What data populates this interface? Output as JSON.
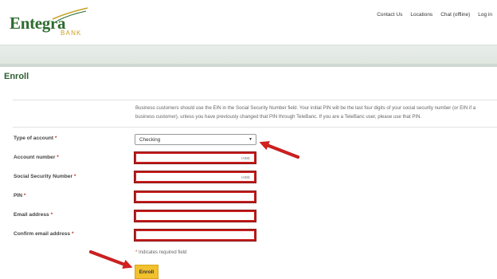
{
  "brand": {
    "name": "Entegra",
    "sub": "BANK"
  },
  "nav": {
    "contact": "Contact Us",
    "locations": "Locations",
    "chat": "Chat (offline)",
    "login": "Log in"
  },
  "page": {
    "title": "Enroll"
  },
  "info": "Business customers should use the EIN in the Social Security Number field. Your initial PIN will be the last four digits of your social security number (or EIN if a business customer), unless you have previously changed that PIN through TeleBanc. If you are a TeleBanc user, please use that PIN.",
  "form": {
    "required_marker": "*",
    "hide_label": "HIDE",
    "fields": [
      {
        "label": "Type of account",
        "type": "select",
        "value": "Checking"
      },
      {
        "label": "Account number",
        "type": "text",
        "hide": true
      },
      {
        "label": "Social Security Number",
        "type": "text",
        "hide": true
      },
      {
        "label": "PIN",
        "type": "text"
      },
      {
        "label": "Email address",
        "type": "text"
      },
      {
        "label": "Confirm email address",
        "type": "text"
      }
    ],
    "required_note": "Indicates required field",
    "submit": "Enroll"
  },
  "colors": {
    "brand_green": "#2e6b2f",
    "gold": "#c9a227",
    "highlight_red": "#c51d1d",
    "button_yellow": "#f2c12e"
  }
}
